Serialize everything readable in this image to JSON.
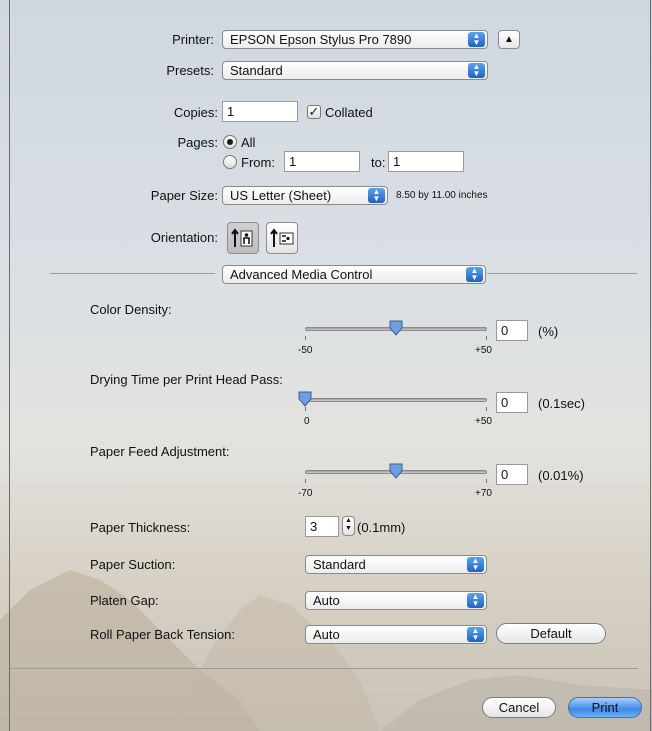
{
  "printer": {
    "label": "Printer:",
    "value": "EPSON Epson Stylus Pro 7890"
  },
  "presets": {
    "label": "Presets:",
    "value": "Standard"
  },
  "copies": {
    "label": "Copies:",
    "value": "1",
    "collated_label": "Collated",
    "collated_checked": true
  },
  "pages": {
    "label": "Pages:",
    "all_label": "All",
    "from_label": "From:",
    "from_value": "1",
    "to_label": "to:",
    "to_value": "1",
    "selected": "All"
  },
  "paper_size": {
    "label": "Paper Size:",
    "value": "US Letter (Sheet)",
    "dimensions": "8.50 by 11.00 inches"
  },
  "orientation": {
    "label": "Orientation:",
    "selected": "portrait"
  },
  "panel_menu": {
    "value": "Advanced Media Control"
  },
  "color_density": {
    "label": "Color Density:",
    "min_label": "-50",
    "max_label": "+50",
    "value": "0",
    "unit": "(%)",
    "min": -50,
    "max": 50,
    "current": 0
  },
  "drying_time": {
    "label": "Drying Time per Print Head Pass:",
    "min_label": "0",
    "max_label": "+50",
    "value": "0",
    "unit": "(0.1sec)",
    "min": 0,
    "max": 50,
    "current": 0
  },
  "paper_feed": {
    "label": "Paper Feed Adjustment:",
    "min_label": "-70",
    "max_label": "+70",
    "value": "0",
    "unit": "(0.01%)",
    "min": -70,
    "max": 70,
    "current": 0
  },
  "paper_thickness": {
    "label": "Paper Thickness:",
    "value": "3",
    "unit": "(0.1mm)"
  },
  "paper_suction": {
    "label": "Paper Suction:",
    "value": "Standard"
  },
  "platen_gap": {
    "label": "Platen Gap:",
    "value": "Auto"
  },
  "roll_tension": {
    "label": "Roll Paper Back Tension:",
    "value": "Auto",
    "default_button": "Default"
  },
  "footer": {
    "cancel": "Cancel",
    "print": "Print"
  },
  "colors": {
    "accent": "#3c8ae8"
  }
}
